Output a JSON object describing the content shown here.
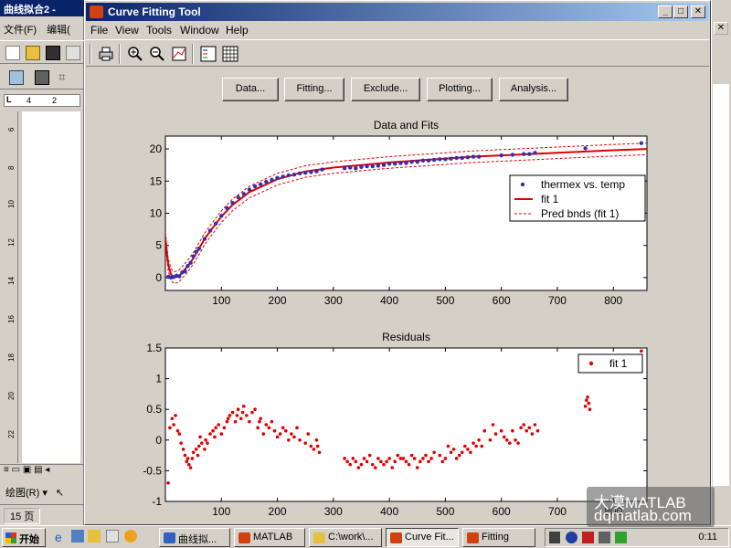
{
  "background_window": {
    "title": "曲线拟合2 -",
    "menu": [
      "文件(F)",
      "编辑("
    ],
    "ruler_top": [
      "4",
      "2"
    ],
    "ruler_side": [
      "6",
      "8",
      "10",
      "12",
      "14",
      "16",
      "18",
      "20",
      "22"
    ],
    "draw_menu": "绘图(R) ▾",
    "page_status": "15 页"
  },
  "window": {
    "title": "Curve Fitting Tool",
    "menu": [
      "File",
      "View",
      "Tools",
      "Window",
      "Help"
    ],
    "buttons": [
      "Data...",
      "Fitting...",
      "Exclude...",
      "Plotting...",
      "Analysis..."
    ]
  },
  "chart_data": [
    {
      "type": "scatter",
      "title": "Data and Fits",
      "xlim": [
        0,
        860
      ],
      "ylim": [
        -2,
        22
      ],
      "xticks": [
        100,
        200,
        300,
        400,
        500,
        600,
        700,
        800
      ],
      "yticks": [
        0,
        5,
        10,
        15,
        20
      ],
      "grid": false,
      "legend": {
        "position": "right-middle",
        "entries": [
          "thermex vs. temp",
          "fit 1",
          "Pred bnds (fit 1)"
        ]
      },
      "colors": {
        "data": "#3030b0",
        "fit": "#e00000",
        "bounds": "#e00000"
      },
      "series": [
        {
          "name": "thermex vs. temp",
          "kind": "points",
          "x": [
            5,
            10,
            15,
            20,
            25,
            30,
            35,
            40,
            45,
            50,
            55,
            60,
            70,
            80,
            90,
            100,
            110,
            120,
            130,
            140,
            150,
            160,
            170,
            180,
            190,
            200,
            210,
            220,
            230,
            240,
            250,
            260,
            270,
            280,
            320,
            330,
            340,
            350,
            360,
            370,
            380,
            390,
            400,
            410,
            420,
            430,
            440,
            450,
            460,
            470,
            480,
            490,
            500,
            510,
            520,
            530,
            540,
            550,
            560,
            600,
            620,
            640,
            650,
            660,
            750,
            850
          ],
          "y": [
            0.1,
            0.0,
            0.1,
            0.3,
            0.2,
            0.8,
            1.0,
            1.8,
            2.3,
            3.3,
            4.0,
            4.5,
            6.0,
            7.3,
            8.4,
            9.6,
            10.8,
            11.6,
            12.5,
            13.0,
            13.7,
            14.2,
            14.5,
            14.9,
            15.2,
            15.5,
            15.7,
            15.9,
            16.0,
            16.2,
            16.3,
            16.4,
            16.5,
            16.8,
            17.0,
            17.1,
            17.0,
            17.2,
            17.3,
            17.3,
            17.4,
            17.5,
            17.7,
            17.7,
            17.8,
            17.8,
            18.0,
            18.0,
            18.2,
            18.2,
            18.3,
            18.4,
            18.4,
            18.5,
            18.6,
            18.6,
            18.7,
            18.8,
            18.8,
            19.0,
            19.1,
            19.2,
            19.2,
            19.4,
            20.1,
            20.9
          ]
        },
        {
          "name": "fit 1",
          "kind": "line",
          "x": [
            0,
            5,
            10,
            15,
            20,
            25,
            30,
            40,
            50,
            60,
            70,
            80,
            100,
            120,
            150,
            200,
            250,
            300,
            350,
            400,
            450,
            500,
            550,
            600,
            650,
            700,
            750,
            800,
            860
          ],
          "y": [
            6.0,
            2.0,
            0.5,
            0.0,
            0.1,
            0.3,
            0.8,
            1.8,
            3.0,
            4.5,
            6.0,
            7.2,
            9.5,
            11.3,
            13.3,
            15.3,
            16.5,
            17.1,
            17.5,
            17.9,
            18.2,
            18.5,
            18.8,
            19.0,
            19.2,
            19.4,
            19.6,
            19.8,
            20.0
          ]
        },
        {
          "name": "Pred bnds (fit 1)",
          "kind": "dashed",
          "x": [
            0,
            5,
            10,
            15,
            20,
            25,
            30,
            40,
            50,
            60,
            70,
            80,
            100,
            120,
            150,
            200,
            250,
            300,
            350,
            400,
            450,
            500,
            550,
            600,
            650,
            700,
            750,
            800,
            860
          ],
          "y": [
            7.0,
            3.0,
            1.4,
            0.9,
            1.0,
            1.2,
            1.7,
            2.7,
            3.9,
            5.4,
            6.9,
            8.1,
            10.4,
            12.2,
            14.2,
            16.2,
            17.4,
            18.0,
            18.4,
            18.8,
            19.1,
            19.4,
            19.7,
            19.9,
            20.1,
            20.3,
            20.5,
            20.7,
            20.9
          ]
        },
        {
          "name": "Pred bnds (fit 1)",
          "kind": "dashed",
          "x": [
            0,
            5,
            10,
            15,
            20,
            25,
            30,
            40,
            50,
            60,
            70,
            80,
            100,
            120,
            150,
            200,
            250,
            300,
            350,
            400,
            450,
            500,
            550,
            600,
            650,
            700,
            750,
            800,
            860
          ],
          "y": [
            5.0,
            1.0,
            -0.4,
            -0.9,
            -0.8,
            -0.6,
            -0.1,
            0.9,
            2.1,
            3.6,
            5.1,
            6.3,
            8.6,
            10.4,
            12.4,
            14.4,
            15.6,
            16.2,
            16.6,
            17.0,
            17.3,
            17.6,
            17.9,
            18.1,
            18.3,
            18.5,
            18.7,
            18.9,
            19.1
          ]
        }
      ]
    },
    {
      "type": "scatter",
      "title": "Residuals",
      "xlim": [
        0,
        860
      ],
      "ylim": [
        -1,
        1.5
      ],
      "xticks": [
        100,
        200,
        300,
        400,
        500,
        600,
        700,
        800
      ],
      "yticks": [
        -1,
        -0.5,
        0,
        0.5,
        1,
        1.5
      ],
      "grid": false,
      "legend": {
        "position": "top-right",
        "entries": [
          "fit 1"
        ]
      },
      "colors": {
        "data": "#e00000"
      },
      "series": [
        {
          "name": "fit 1",
          "x": [
            5,
            8,
            12,
            15,
            18,
            22,
            25,
            28,
            32,
            35,
            38,
            40,
            42,
            45,
            48,
            50,
            55,
            58,
            60,
            62,
            65,
            70,
            72,
            75,
            80,
            85,
            88,
            90,
            95,
            100,
            105,
            110,
            112,
            115,
            120,
            125,
            128,
            130,
            135,
            138,
            140,
            145,
            150,
            155,
            160,
            165,
            168,
            170,
            175,
            180,
            185,
            190,
            195,
            200,
            205,
            210,
            215,
            220,
            225,
            230,
            235,
            240,
            250,
            255,
            260,
            265,
            270,
            272,
            275,
            320,
            325,
            330,
            335,
            340,
            345,
            350,
            355,
            360,
            365,
            370,
            375,
            380,
            385,
            390,
            395,
            400,
            405,
            410,
            415,
            420,
            425,
            430,
            435,
            440,
            445,
            450,
            455,
            460,
            465,
            470,
            475,
            480,
            490,
            495,
            500,
            505,
            510,
            515,
            520,
            525,
            530,
            535,
            540,
            545,
            550,
            555,
            560,
            565,
            570,
            580,
            585,
            590,
            600,
            605,
            610,
            615,
            620,
            625,
            630,
            635,
            640,
            645,
            650,
            655,
            660,
            665,
            750,
            752,
            754,
            756,
            758,
            850
          ],
          "y": [
            -0.7,
            0.2,
            0.35,
            0.25,
            0.4,
            0.15,
            0.1,
            -0.05,
            -0.15,
            -0.25,
            -0.35,
            -0.3,
            -0.4,
            -0.45,
            -0.3,
            -0.2,
            -0.15,
            -0.25,
            -0.1,
            0.05,
            -0.05,
            -0.15,
            0.0,
            -0.05,
            0.1,
            0.15,
            0.05,
            0.2,
            0.25,
            0.1,
            0.2,
            0.3,
            0.35,
            0.4,
            0.45,
            0.3,
            0.4,
            0.5,
            0.35,
            0.45,
            0.55,
            0.4,
            0.3,
            0.45,
            0.5,
            0.2,
            0.3,
            0.35,
            0.1,
            0.25,
            0.2,
            0.3,
            0.15,
            0.05,
            0.1,
            0.2,
            0.15,
            0.0,
            0.1,
            0.05,
            0.2,
            0.0,
            -0.05,
            0.1,
            -0.1,
            -0.15,
            0.0,
            -0.1,
            -0.2,
            -0.3,
            -0.35,
            -0.4,
            -0.3,
            -0.35,
            -0.45,
            -0.4,
            -0.3,
            -0.35,
            -0.25,
            -0.4,
            -0.45,
            -0.3,
            -0.35,
            -0.4,
            -0.35,
            -0.3,
            -0.45,
            -0.35,
            -0.25,
            -0.3,
            -0.3,
            -0.35,
            -0.4,
            -0.25,
            -0.3,
            -0.45,
            -0.35,
            -0.3,
            -0.25,
            -0.35,
            -0.3,
            -0.2,
            -0.25,
            -0.35,
            -0.3,
            -0.1,
            -0.2,
            -0.15,
            -0.3,
            -0.25,
            -0.2,
            -0.1,
            -0.15,
            -0.2,
            -0.05,
            -0.1,
            0.0,
            -0.1,
            0.15,
            0.0,
            0.25,
            0.1,
            0.15,
            0.05,
            0.0,
            -0.05,
            0.15,
            0.0,
            -0.05,
            0.2,
            0.25,
            0.15,
            0.2,
            0.1,
            0.25,
            0.15,
            0.55,
            0.65,
            0.7,
            0.6,
            0.5,
            1.45
          ]
        }
      ]
    }
  ],
  "taskbar": {
    "start": "开始",
    "tasks": [
      "曲线拟...",
      "MATLAB",
      "C:\\work\\...",
      "Curve Fit...",
      "Fitting"
    ],
    "clock": "0:11"
  },
  "watermark": [
    "大漠MATLAB",
    "dqmatlab.com"
  ]
}
